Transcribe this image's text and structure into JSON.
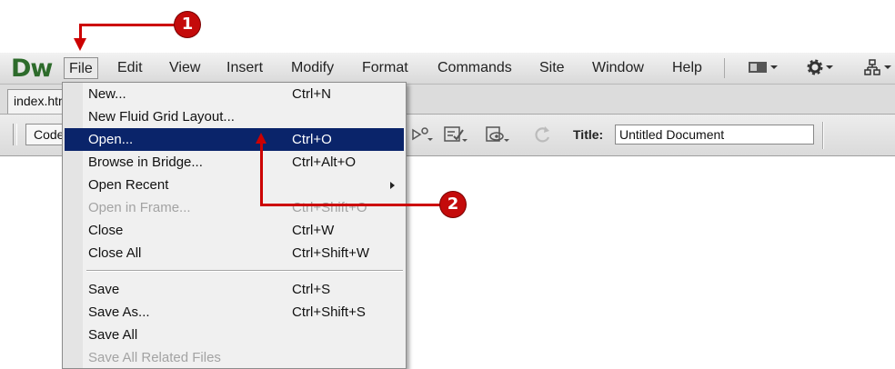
{
  "app": {
    "logo": "Dw"
  },
  "menubar": {
    "items": [
      {
        "label": "File",
        "active": true
      },
      {
        "label": "Edit"
      },
      {
        "label": "View"
      },
      {
        "label": "Insert"
      },
      {
        "label": "Modify"
      },
      {
        "label": "Format"
      },
      {
        "label": "Commands"
      },
      {
        "label": "Site"
      },
      {
        "label": "Window"
      },
      {
        "label": "Help"
      }
    ],
    "icons": [
      "layout-icon",
      "gear-icon",
      "site-structure-icon"
    ]
  },
  "tabs": {
    "doc_tab": "index.html"
  },
  "toolbar": {
    "code_button": "Code",
    "title_label": "Title:",
    "title_value": "Untitled Document"
  },
  "file_menu": {
    "items": [
      {
        "label": "New...",
        "shortcut": "Ctrl+N"
      },
      {
        "label": "New Fluid Grid Layout...",
        "shortcut": ""
      },
      {
        "label": "Open...",
        "shortcut": "Ctrl+O",
        "highlighted": true
      },
      {
        "label": "Browse in Bridge...",
        "shortcut": "Ctrl+Alt+O"
      },
      {
        "label": "Open Recent",
        "shortcut": "",
        "submenu": true
      },
      {
        "label": "Open in Frame...",
        "shortcut": "Ctrl+Shift+O",
        "disabled": true
      },
      {
        "label": "Close",
        "shortcut": "Ctrl+W"
      },
      {
        "label": "Close All",
        "shortcut": "Ctrl+Shift+W"
      },
      {
        "label": "Save",
        "shortcut": "Ctrl+S"
      },
      {
        "label": "Save As...",
        "shortcut": "Ctrl+Shift+S"
      },
      {
        "label": "Save All",
        "shortcut": ""
      },
      {
        "label": "Save All Related Files",
        "shortcut": "",
        "disabled": true
      }
    ]
  },
  "callouts": {
    "step1": "1",
    "step2": "2",
    "color": "#cc0000"
  }
}
